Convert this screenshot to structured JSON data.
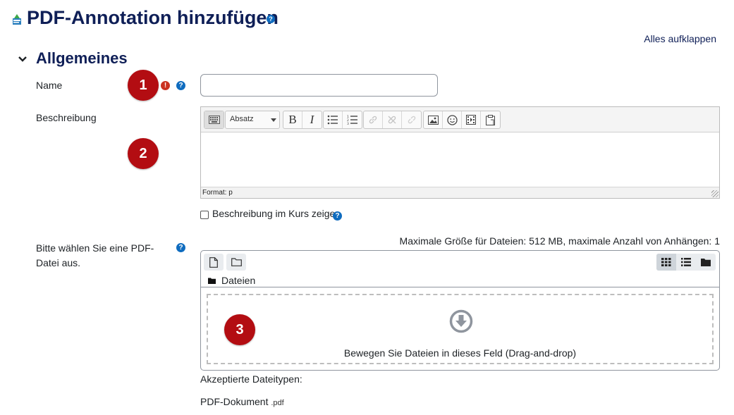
{
  "header": {
    "title": "PDF-Annotation hinzufügen",
    "expand_all": "Alles aufklappen"
  },
  "section": {
    "title": "Allgemeines"
  },
  "fields": {
    "name": {
      "label": "Name",
      "value": ""
    },
    "description": {
      "label": "Beschreibung",
      "format_select": "Absatz",
      "status": "Format: p",
      "show_in_course_label": "Beschreibung im Kurs zeigen",
      "show_in_course_checked": false
    },
    "pdf": {
      "label": "Bitte wählen Sie eine PDF-Datei aus.",
      "max_size": "Maximale Größe für Dateien: 512 MB, maximale Anzahl von Anhängen: 1",
      "path_label": "Dateien",
      "drop_text": "Bewegen Sie Dateien in dieses Feld (Drag-and-drop)",
      "accepted_label": "Akzeptierte Dateitypen:",
      "filetype_name": "PDF-Dokument",
      "filetype_ext": ".pdf"
    }
  },
  "callouts": [
    "1",
    "2",
    "3"
  ],
  "icons": {
    "title_help": "help-icon",
    "required": "required-icon",
    "toolbar": [
      "keyboard-icon",
      "bold-icon",
      "italic-icon",
      "bullet-list-icon",
      "numbered-list-icon",
      "link-icon",
      "unlink-icon",
      "anchor-icon",
      "image-icon",
      "emoji-icon",
      "media-icon",
      "paste-icon"
    ],
    "filepicker": [
      "add-file-icon",
      "create-folder-icon",
      "grid-view-icon",
      "list-view-icon",
      "tree-view-icon",
      "folder-icon",
      "download-arrow-icon"
    ]
  },
  "colors": {
    "title": "#0f1f57",
    "help": "#0f6cbf",
    "required": "#ca3120",
    "callout": "#b30d12"
  }
}
